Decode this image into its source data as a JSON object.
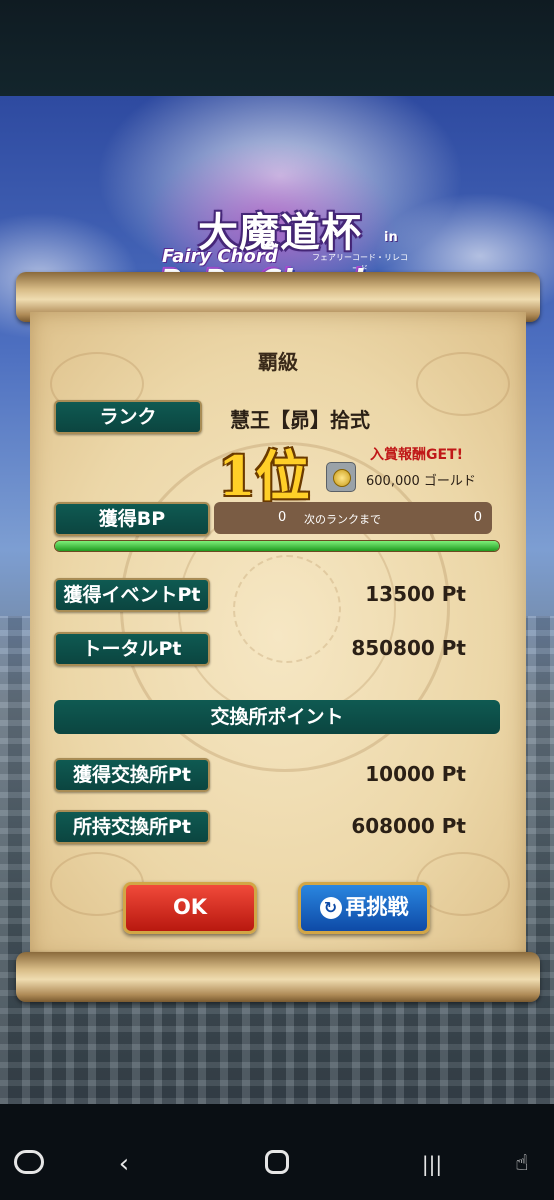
{
  "logo": {
    "kanji": "大魔道杯",
    "in": "in",
    "fairy_chord": "Fairy Chord",
    "kana": "フェアリーコード・リレコード",
    "rerechord": "ReRe Chord"
  },
  "result": {
    "title": "覇級",
    "rank_label": "ランク",
    "rank_value": "慧王【昴】拾式",
    "position": "1位",
    "reward_get": "入賞報酬GET!",
    "reward_amount": "600,000 ゴールド",
    "bp_label": "獲得BP",
    "bp_value": "0",
    "next_rank_label": "次のランクまで",
    "next_rank_value": "0",
    "bp_progress": 1.0,
    "event_pt_label": "獲得イベントPt",
    "event_pt_value": "13500 Pt",
    "total_pt_label": "トータルPt",
    "total_pt_value": "850800 Pt",
    "exchange_header": "交換所ポイント",
    "earned_exchange_label": "獲得交換所Pt",
    "earned_exchange_value": "10000 Pt",
    "held_exchange_label": "所持交換所Pt",
    "held_exchange_value": "608000 Pt"
  },
  "buttons": {
    "ok": "OK",
    "retry": "再挑戦"
  },
  "navbar": {
    "back": "‹",
    "recents": "|||",
    "accessibility": "☝"
  },
  "colors": {
    "plate": "#0f5a52",
    "ok_button": "#d9281c",
    "retry_button": "#1a66c8",
    "progress": "#3bc23a",
    "reward_text": "#c01818"
  }
}
